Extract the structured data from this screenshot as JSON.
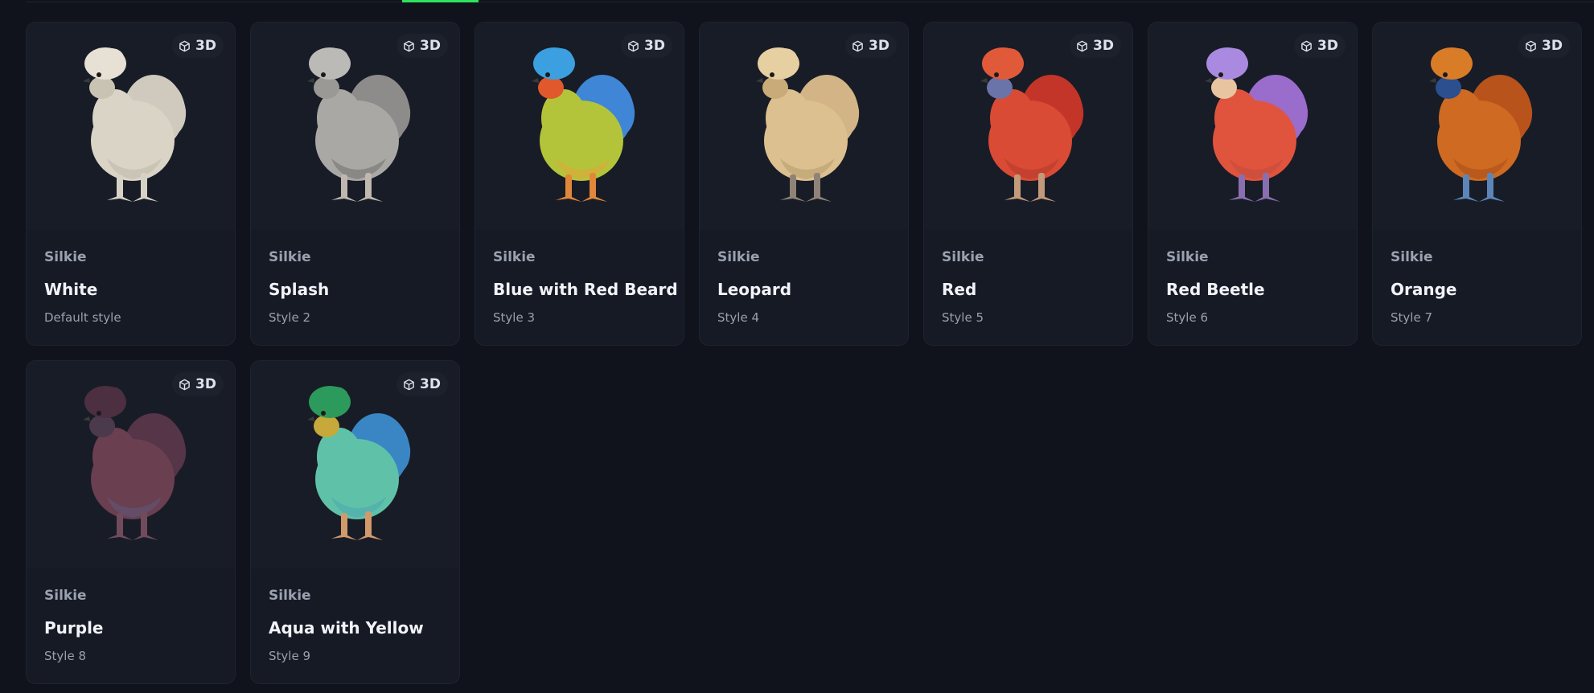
{
  "badge_label": "3D",
  "cards": [
    {
      "breed": "Silkie",
      "name": "White",
      "style": "Default style",
      "colors": {
        "body": "#d9d4c6",
        "tail": "#cfcabd",
        "crest": "#e6e1d4",
        "beard": "#c9c3b3",
        "legs": "#d7d2c6",
        "accent": "#bdb7a8"
      }
    },
    {
      "breed": "Silkie",
      "name": "Splash",
      "style": "Style 2",
      "colors": {
        "body": "#a9a8a5",
        "tail": "#8d8c8a",
        "crest": "#bcbab6",
        "beard": "#9a9996",
        "legs": "#c0b8ae",
        "accent": "#6f6e6c"
      }
    },
    {
      "breed": "Silkie",
      "name": "Blue with Red Beard",
      "style": "Style 3",
      "colors": {
        "body": "#b4c43a",
        "tail": "#3f86d6",
        "crest": "#3b9fe0",
        "beard": "#e0582c",
        "legs": "#e0873a",
        "accent": "#e6a43a"
      }
    },
    {
      "breed": "Silkie",
      "name": "Leopard",
      "style": "Style 4",
      "colors": {
        "body": "#dcc08f",
        "tail": "#d2b487",
        "crest": "#e6cfa1",
        "beard": "#c9ab79",
        "legs": "#8d8377",
        "accent": "#b79a6c"
      }
    },
    {
      "breed": "Silkie",
      "name": "Red",
      "style": "Style 5",
      "colors": {
        "body": "#d94b34",
        "tail": "#c23528",
        "crest": "#e05a3a",
        "beard": "#6a74a8",
        "legs": "#c29a7a",
        "accent": "#b23a2b"
      }
    },
    {
      "breed": "Silkie",
      "name": "Red Beetle",
      "style": "Style 6",
      "colors": {
        "body": "#e0543e",
        "tail": "#9a6ccc",
        "crest": "#a98ae0",
        "beard": "#e8c5a0",
        "legs": "#8a6fb0",
        "accent": "#c04a3a"
      }
    },
    {
      "breed": "Silkie",
      "name": "Orange",
      "style": "Style 7",
      "colors": {
        "body": "#cf6a22",
        "tail": "#b8531b",
        "crest": "#d87c28",
        "beard": "#2b4f8f",
        "legs": "#5d86b8",
        "accent": "#a84d17"
      }
    },
    {
      "breed": "Silkie",
      "name": "Purple",
      "style": "Style 8",
      "colors": {
        "body": "#6a3f4f",
        "tail": "#553547",
        "crest": "#4c2f40",
        "beard": "#4a3a4c",
        "legs": "#704b5c",
        "accent": "#5c5a80"
      }
    },
    {
      "breed": "Silkie",
      "name": "Aqua with Yellow",
      "style": "Style 9",
      "colors": {
        "body": "#5fc2a8",
        "tail": "#3a86c4",
        "crest": "#2c9a5a",
        "beard": "#c6a93a",
        "legs": "#d29a6a",
        "accent": "#4aa7b0"
      }
    }
  ]
}
